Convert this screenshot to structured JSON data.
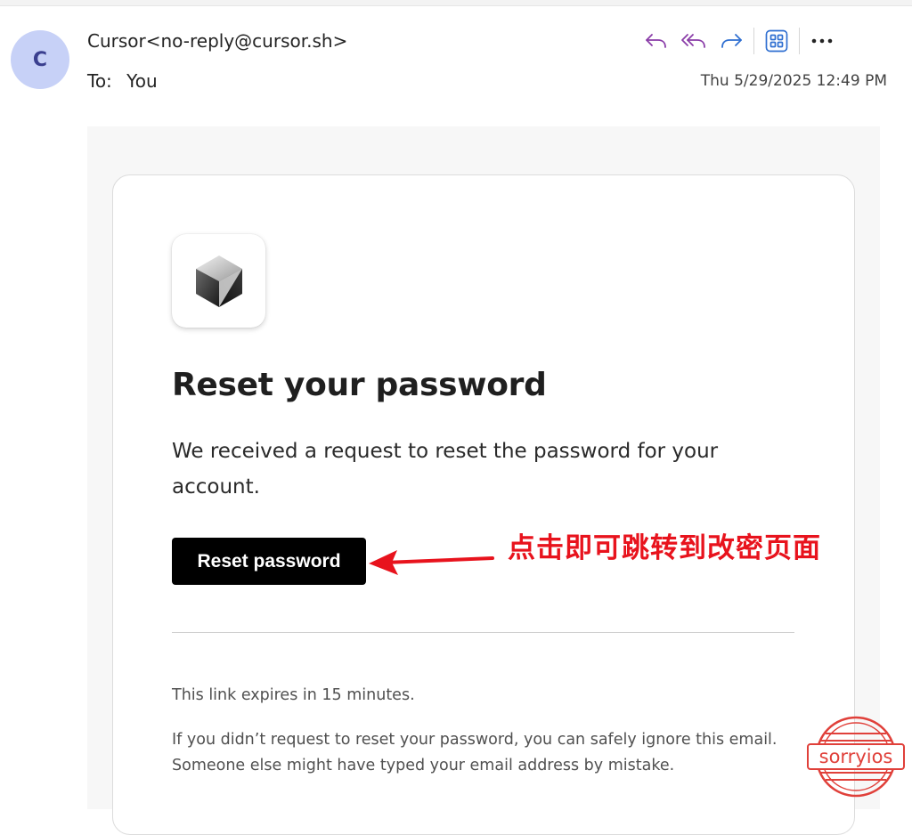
{
  "header": {
    "avatar_letter": "C",
    "sender": "Cursor<no-reply@cursor.sh>",
    "to_label": "To:",
    "to_value": "You",
    "date": "Thu 5/29/2025 12:49 PM",
    "actions": [
      {
        "icon": "reply-icon",
        "color": "#8a3da8"
      },
      {
        "icon": "reply-all-icon",
        "color": "#8a3da8"
      },
      {
        "icon": "forward-icon",
        "color": "#2f6fd1"
      },
      {
        "icon": "apps-icon",
        "color": "#2f6fd1"
      },
      {
        "icon": "more-icon",
        "color": "#242424"
      }
    ]
  },
  "email": {
    "logo": "cursor-logo-icon",
    "heading": "Reset your password",
    "body": "We received a request to reset the password for your account.",
    "button_label": "Reset password",
    "expires_note": "This link expires in 15 minutes.",
    "ignore_note": "If you didn’t request to reset your password, you can safely ignore this email. Someone else might have typed your email address by mistake."
  },
  "annotation": {
    "text": "点击即可跳转到改密页面",
    "color": "#e8131d"
  },
  "watermark": {
    "text": "sorryios",
    "color": "#e0403a"
  }
}
